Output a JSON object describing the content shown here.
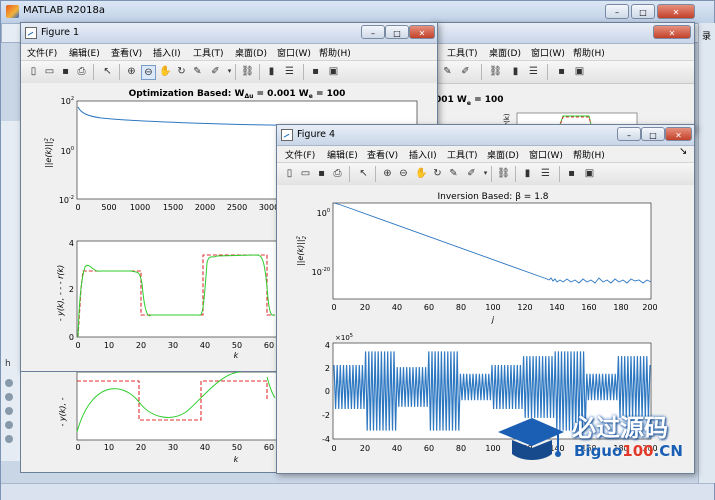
{
  "main_window": {
    "title": "MATLAB R2018a",
    "side_text": "录",
    "bg_menu": [
      "文件(F)",
      "编辑(E)",
      "查看(V)",
      "插入(I)",
      "工具(T)",
      "桌面(D)",
      "窗口(W)",
      "帮助(H)"
    ],
    "bg_title_fragment": "001 W",
    "bg_title_fragment2": "= 100",
    "bg_figure_ylabel": "y(k)",
    "bg_left_label": "h"
  },
  "figure1": {
    "title": "Figure 1",
    "menu": [
      "文件(F)",
      "编辑(E)",
      "查看(V)",
      "插入(I)",
      "工具(T)",
      "桌面(D)",
      "窗口(W)",
      "帮助(H)"
    ],
    "top_plot": {
      "title_prefix": "Optimization Based: ",
      "title_w1": "W",
      "title_sub1": "Δu",
      "title_eq1": " = 0.001 ",
      "title_w2": "W",
      "title_sub2": "e",
      "title_eq2": " = 100",
      "ylabel": "||e(k)||",
      "ylabel_sup": "2",
      "ylabel_sub": "2",
      "yticks": [
        {
          "v": "10",
          "e": "2"
        },
        {
          "v": "10",
          "e": "0"
        },
        {
          "v": "10",
          "e": "-2"
        }
      ],
      "xticks": [
        "0",
        "500",
        "1000",
        "1500",
        "2000",
        "2500",
        "3000"
      ]
    },
    "bottom_plot": {
      "ylabel": "- y(k), - - - r(k)",
      "xlabel": "k",
      "yticks": [
        "4",
        "2",
        "0"
      ],
      "xticks": [
        "0",
        "10",
        "20",
        "30",
        "40",
        "50",
        "60"
      ]
    },
    "lower_peek": {
      "ylabel": "- y(k), -",
      "xlabel": "k",
      "xticks": [
        "0",
        "10",
        "20",
        "30",
        "40",
        "50",
        "60"
      ]
    }
  },
  "figure4": {
    "title": "Figure 4",
    "menu": [
      "文件(F)",
      "编辑(E)",
      "查看(V)",
      "插入(I)",
      "工具(T)",
      "桌面(D)",
      "窗口(W)",
      "帮助(H)"
    ],
    "top_plot": {
      "title": "Inversion Based: β = 1.8",
      "ylabel": "||e(k)||",
      "ylabel_sup": "2",
      "ylabel_sub": "2",
      "yticks": [
        {
          "v": "10",
          "e": "0"
        },
        {
          "v": "10",
          "e": "-20"
        }
      ],
      "xticks": [
        "0",
        "20",
        "40",
        "60",
        "80",
        "100",
        "120",
        "140",
        "160",
        "180",
        "200"
      ],
      "xlabel": "j"
    },
    "bottom_plot": {
      "exponent": "×10",
      "exponent_power": "5",
      "yticks": [
        "4",
        "2",
        "0",
        "-2",
        "-4"
      ],
      "xticks": [
        "0",
        "20",
        "40",
        "60",
        "80",
        "100",
        "120",
        "140",
        "160",
        "180",
        "200"
      ]
    }
  },
  "watermark": {
    "cn": "必过源码",
    "en_prefix": "Biguo",
    "en_num": "100",
    "en_suffix": ".CN"
  },
  "colors": {
    "line_blue": "#2e78c2",
    "line_green": "#2ecc2e",
    "line_red_dash": "#e03030"
  }
}
